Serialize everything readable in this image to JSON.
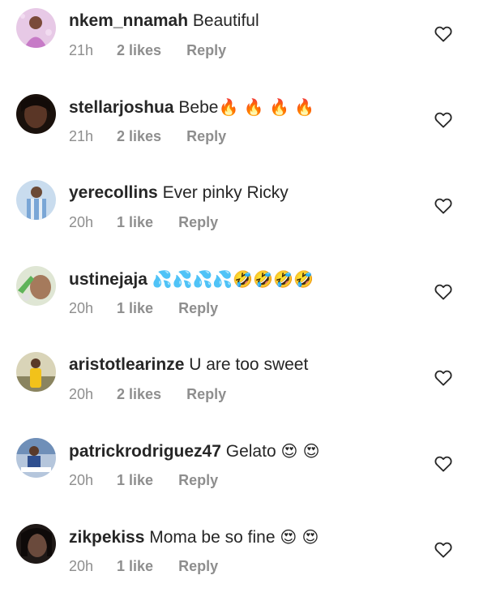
{
  "comments": [
    {
      "username": "nkem_nnamah",
      "message": "Beautiful",
      "emojis": "",
      "time": "21h",
      "likes": "2 likes",
      "reply": "Reply",
      "avatar_color": "#d8a6d8"
    },
    {
      "username": "stellarjoshua",
      "message": "Bebe",
      "emojis": "🔥 🔥 🔥 🔥",
      "time": "21h",
      "likes": "2 likes",
      "reply": "Reply",
      "avatar_color": "#3a2418"
    },
    {
      "username": "yerecollins",
      "message": "Ever pinky Ricky",
      "emojis": "",
      "time": "20h",
      "likes": "1 like",
      "reply": "Reply",
      "avatar_color": "#a9c4de"
    },
    {
      "username": "ustinejaja",
      "message": "",
      "emojis": "💦💦💦💦🤣🤣🤣🤣",
      "time": "20h",
      "likes": "1 like",
      "reply": "Reply",
      "avatar_color": "#cfd8c2"
    },
    {
      "username": "aristotlearinze",
      "message": "U are too sweet",
      "emojis": "",
      "time": "20h",
      "likes": "2 likes",
      "reply": "Reply",
      "avatar_color": "#b8b48a"
    },
    {
      "username": "patrickrodriguez47",
      "message": "Gelato",
      "emojis": "😍 😍",
      "time": "20h",
      "likes": "1 like",
      "reply": "Reply",
      "avatar_color": "#8fa7c8"
    },
    {
      "username": "zikpekiss",
      "message": "Moma be so fine",
      "emojis": "😍 😍",
      "time": "20h",
      "likes": "1 like",
      "reply": "Reply",
      "avatar_color": "#2a2220"
    }
  ],
  "icons": {
    "like": "heart-outline-icon"
  }
}
